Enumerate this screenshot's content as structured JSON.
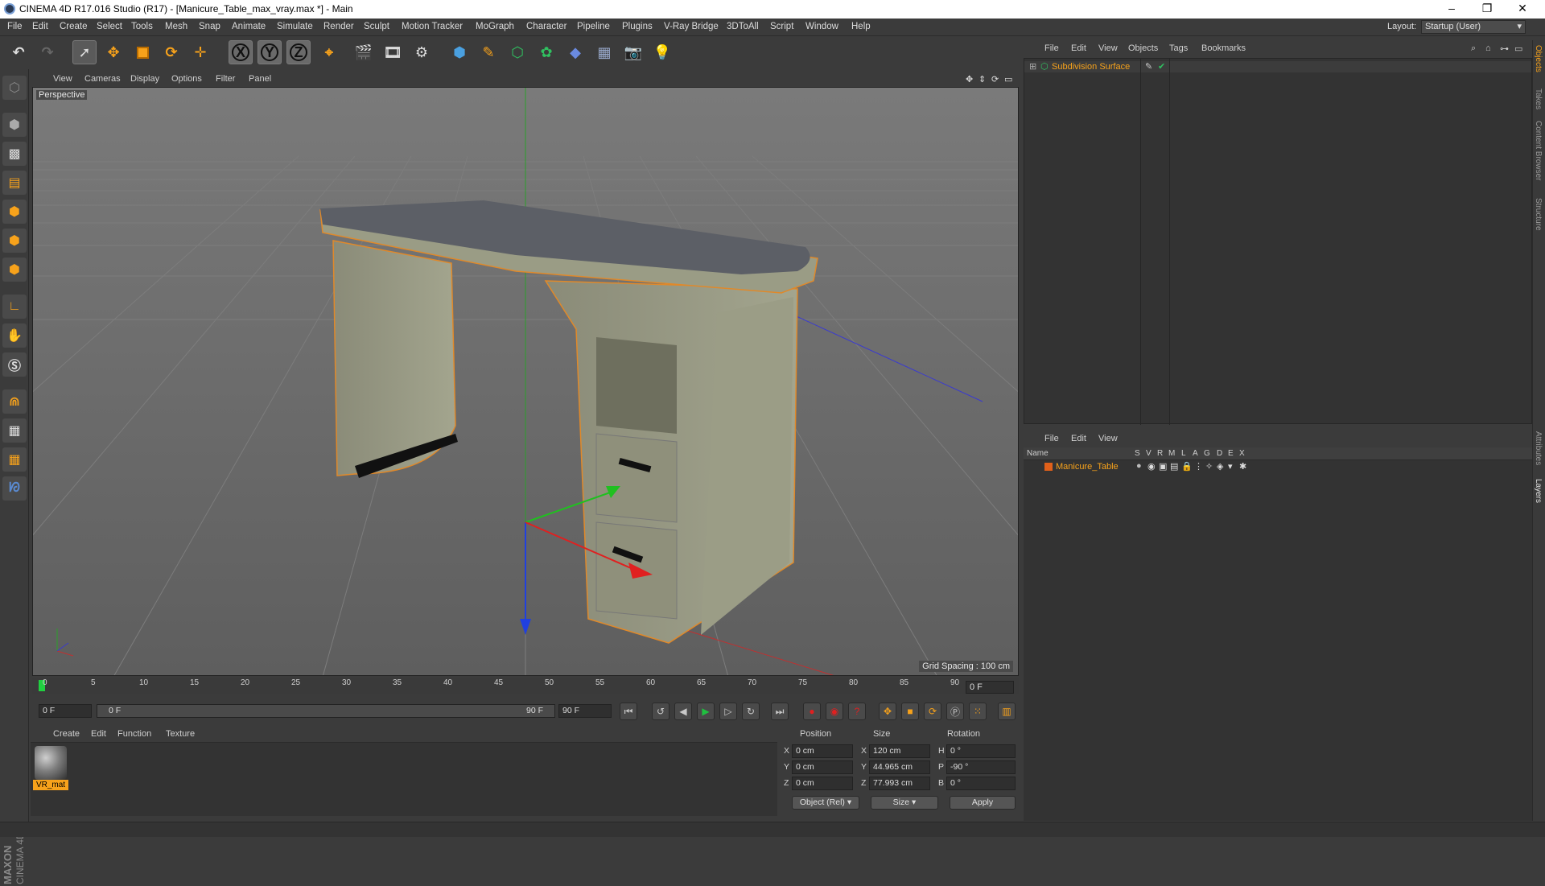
{
  "window": {
    "title": "CINEMA 4D R17.016 Studio (R17) - [Manicure_Table_max_vray.max *] - Main",
    "minimize": "–",
    "restore": "❐",
    "close": "✕"
  },
  "menubar": [
    "File",
    "Edit",
    "Create",
    "Select",
    "Tools",
    "Mesh",
    "Snap",
    "Animate",
    "Simulate",
    "Render",
    "Sculpt",
    "Motion Tracker",
    "MoGraph",
    "Character",
    "Pipeline",
    "Plugins",
    "V-Ray Bridge",
    "3DToAll",
    "Script",
    "Window",
    "Help"
  ],
  "layout": {
    "label": "Layout:",
    "value": "Startup (User)"
  },
  "toolbar": {
    "axis_x": "X",
    "axis_y": "Y",
    "axis_z": "Z"
  },
  "viewport": {
    "menu": [
      "View",
      "Cameras",
      "Display",
      "Options",
      "Filter",
      "Panel"
    ],
    "camera_label": "Perspective",
    "grid_spacing": "Grid Spacing : 100 cm"
  },
  "timeline": {
    "ticks": [
      "0",
      "5",
      "10",
      "15",
      "20",
      "25",
      "30",
      "35",
      "40",
      "45",
      "50",
      "55",
      "60",
      "65",
      "70",
      "75",
      "80",
      "85",
      "90"
    ],
    "frame_end_display": "0 F"
  },
  "transport": {
    "start_frame": "0 F",
    "range_start": "0 F",
    "range_end": "90 F",
    "end_frame": "90 F"
  },
  "materials": {
    "menu": [
      "Create",
      "Edit",
      "Function",
      "Texture"
    ],
    "items": [
      {
        "name": "VR_mat"
      }
    ]
  },
  "coords": {
    "headers": {
      "position": "Position",
      "size": "Size",
      "rotation": "Rotation"
    },
    "rows": [
      {
        "axis": "X",
        "pos": "0 cm",
        "size_axis": "X",
        "size": "120 cm",
        "rot_axis": "H",
        "rot": "0 °"
      },
      {
        "axis": "Y",
        "pos": "0 cm",
        "size_axis": "Y",
        "size": "44.965 cm",
        "rot_axis": "P",
        "rot": "-90 °"
      },
      {
        "axis": "Z",
        "pos": "0 cm",
        "size_axis": "Z",
        "size": "77.993 cm",
        "rot_axis": "B",
        "rot": "0 °"
      }
    ],
    "mode": "Object (Rel)",
    "size_mode": "Size",
    "apply": "Apply"
  },
  "objects": {
    "menu": [
      "File",
      "Edit",
      "View",
      "Objects",
      "Tags",
      "Bookmarks"
    ],
    "items": [
      {
        "name": "Subdivision Surface"
      }
    ]
  },
  "layers": {
    "menu": [
      "File",
      "Edit",
      "View"
    ],
    "columns": [
      "Name",
      "S",
      "V",
      "R",
      "M",
      "L",
      "A",
      "G",
      "D",
      "E",
      "X"
    ],
    "items": [
      {
        "name": "Manicure_Table"
      }
    ]
  },
  "side_tabs": [
    "Objects",
    "Takes",
    "Content Browser",
    "Structure",
    "Attributes",
    "Layers"
  ],
  "brand": {
    "maxon": "MAXON",
    "cinema": "CINEMA 4D"
  },
  "colors": {
    "accent": "#f7a21b",
    "bg": "#3b3b3b",
    "axis_x": "#e02020",
    "axis_y": "#20c020",
    "axis_z": "#2040e0"
  }
}
